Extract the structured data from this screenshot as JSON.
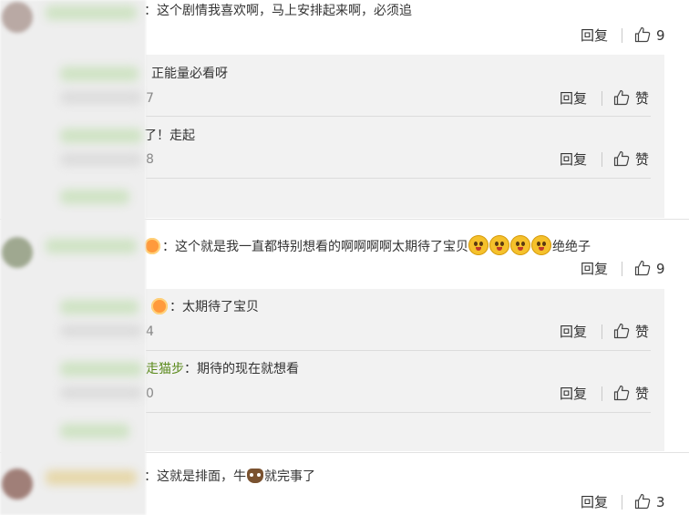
{
  "comments": [
    {
      "text": "：这个剧情我喜欢啊，马上安排起来啊，必须追",
      "actions": {
        "reply": "回复",
        "likes": "9"
      },
      "replies": [
        {
          "text": "正能量必看呀",
          "time_fragment": "7",
          "actions": {
            "reply": "回复",
            "like": "赞"
          }
        },
        {
          "text": "了！走起",
          "time_fragment": "8",
          "actions": {
            "reply": "回复",
            "like": "赞"
          }
        }
      ]
    },
    {
      "text_before_emoji": "：这个就是我一直都特别想看的啊啊啊啊太期待了宝贝",
      "text_after_emoji": "绝绝子",
      "actions": {
        "reply": "回复",
        "likes": "9"
      },
      "replies": [
        {
          "text": "：太期待了宝贝",
          "time_fragment": "4",
          "actions": {
            "reply": "回复",
            "like": "赞"
          }
        },
        {
          "username": "走猫步",
          "text": "：期待的现在就想看",
          "time_fragment": "0",
          "actions": {
            "reply": "回复",
            "like": "赞"
          }
        }
      ]
    },
    {
      "text_before_emoji": "：这就是排面，牛",
      "text_after_emoji": "就完事了",
      "actions": {
        "reply": "回复",
        "likes": "3"
      }
    }
  ],
  "icons": {
    "emoji": "smile-emoji-icon",
    "cow": "cow-emoji-icon",
    "like": "thumbs-up-icon"
  }
}
